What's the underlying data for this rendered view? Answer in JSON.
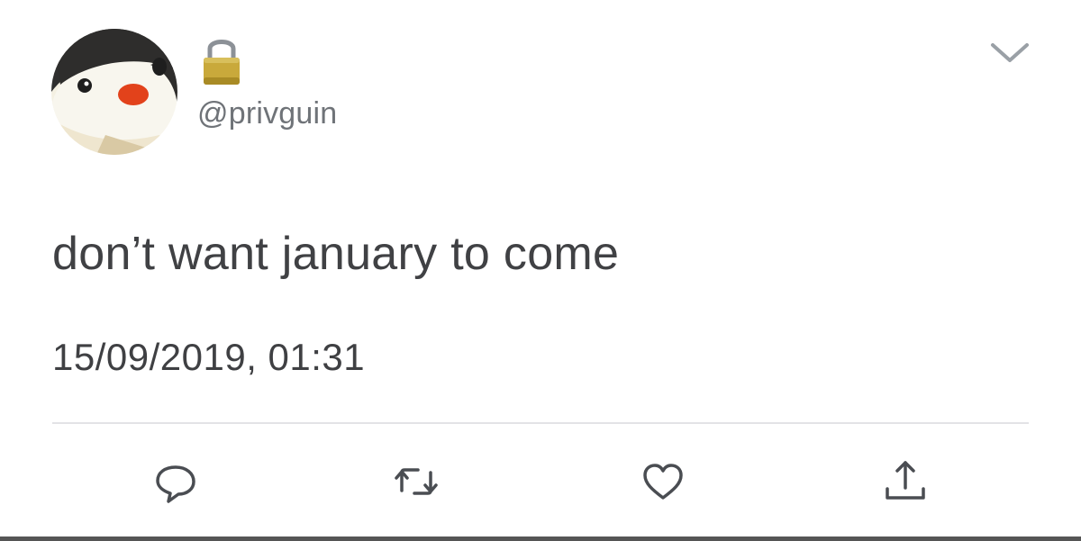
{
  "author": {
    "handle": "@privguin",
    "avatar_icon": "penguin-avatar",
    "protected_icon": "lock-icon"
  },
  "tweet": {
    "text": "don’t want january to come",
    "timestamp": "15/09/2019, 01:31"
  },
  "menu": {
    "icon": "chevron-down-icon"
  },
  "actions": [
    {
      "name": "reply",
      "icon": "reply-icon"
    },
    {
      "name": "retweet",
      "icon": "retweet-icon"
    },
    {
      "name": "like",
      "icon": "heart-icon"
    },
    {
      "name": "share",
      "icon": "share-icon"
    }
  ],
  "colors": {
    "text": "#404144",
    "handle": "#6f7378",
    "icon": "#4a4d52",
    "divider": "#e3e3e6",
    "lock_gold": "#c9a93b"
  }
}
